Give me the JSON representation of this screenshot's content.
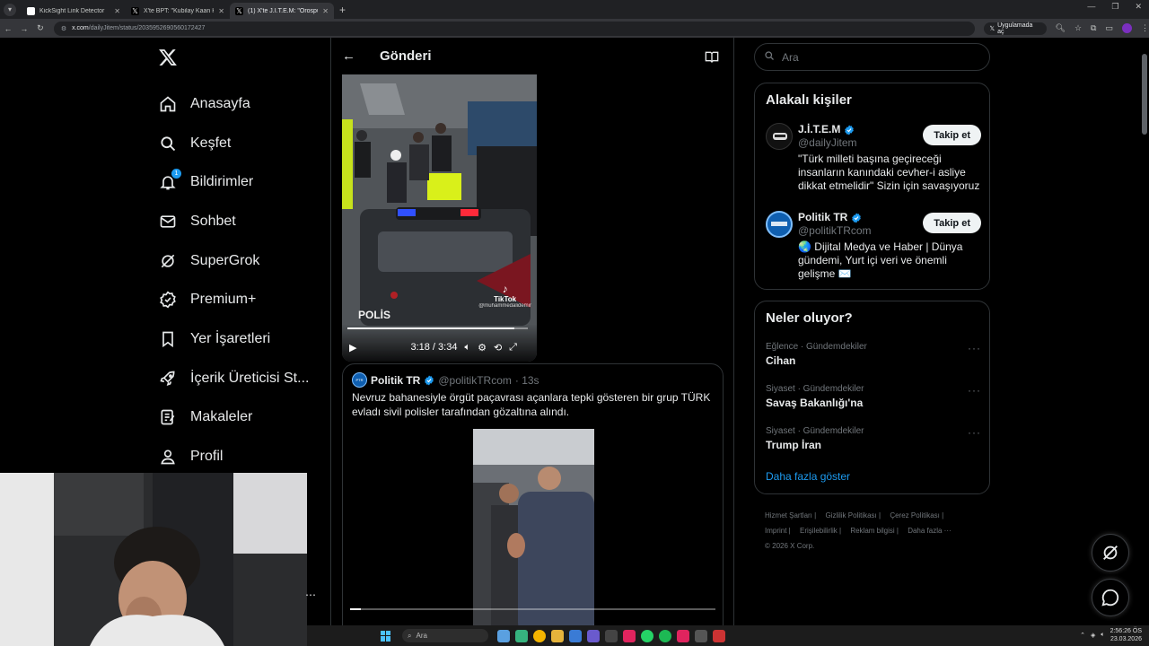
{
  "browser": {
    "tabs": [
      {
        "title": "KickSight Link Detector",
        "active": false
      },
      {
        "title": "X'te BPT: \"Kubilay Kaan Kundak...",
        "active": false
      },
      {
        "title": "(1) X'te J.İ.T.E.M: \"Orospu evladı...",
        "active": true
      }
    ],
    "new_tab": "+",
    "url_domain": "x.com",
    "url_path": "/dailyJitem/status/2035952690560172427",
    "open_in_app": "Uygulamada aç"
  },
  "sidebar": {
    "logo": "X",
    "items": [
      {
        "label": "Anasayfa",
        "icon": "home-icon"
      },
      {
        "label": "Keşfet",
        "icon": "search-icon"
      },
      {
        "label": "Bildirimler",
        "icon": "bell-icon",
        "badge": "1"
      },
      {
        "label": "Sohbet",
        "icon": "mail-icon"
      },
      {
        "label": "SuperGrok",
        "icon": "grok-icon"
      },
      {
        "label": "Premium+",
        "icon": "verified-icon"
      },
      {
        "label": "Yer İşaretleri",
        "icon": "bookmark-icon"
      },
      {
        "label": "İçerik Üreticisi St...",
        "icon": "rocket-icon"
      },
      {
        "label": "Makaleler",
        "icon": "article-icon"
      },
      {
        "label": "Profil",
        "icon": "user-icon"
      }
    ]
  },
  "main": {
    "header_title": "Gönderi",
    "video": {
      "time": "3:18 / 3:34",
      "progress": 0.925,
      "watermark": "TikTok",
      "watermark_user": "@muhammedalidemir",
      "car_text": "POLİS"
    },
    "quote": {
      "name": "Politik TR",
      "handle": "@politikTRcom",
      "time": "· 13s",
      "text": "Nevruz bahanesiyle örgüt paçavrası açanlara tepki gösteren bir grup TÜRK evladı sivil polisler tarafından gözaltına alındı.",
      "progress": 0.03
    }
  },
  "right": {
    "search_placeholder": "Ara",
    "related": {
      "title": "Alakalı kişiler",
      "people": [
        {
          "name": "J.İ.T.E.M",
          "handle": "@dailyJitem",
          "bio": "\"Türk milleti başına geçireceği insanların kanındaki cevher-i asliye dikkat etmelidir\" Sizin için savaşıyoruz",
          "follow": "Takip et"
        },
        {
          "name": "Politik TR",
          "handle": "@politikTRcom",
          "bio": "🌏 Dijital Medya ve Haber | Dünya gündemi, Yurt içi veri ve önemli gelişme ✉️",
          "follow": "Takip et"
        }
      ]
    },
    "trends": {
      "title": "Neler oluyor?",
      "items": [
        {
          "category": "Eğlence · Gündemdekiler",
          "name": "Cihan"
        },
        {
          "category": "Siyaset · Gündemdekiler",
          "name": "Savaş Bakanlığı'na"
        },
        {
          "category": "Siyaset · Gündemdekiler",
          "name": "Trump İran"
        }
      ],
      "show_more": "Daha fazla göster",
      "more": "···"
    },
    "footer": {
      "links": [
        "Hizmet Şartları |",
        "Gizlilik Politikası |",
        "Çerez Politikası |",
        "Imprint |",
        "Erişilebilirlik |",
        "Reklam bilgisi |",
        "Daha fazla ···"
      ],
      "copyright": "© 2026 X Corp."
    }
  },
  "taskbar": {
    "search_label": "Ara",
    "time": "2:56:26 ÖS",
    "date": "23.03.2026"
  },
  "colors": {
    "accent": "#1d9bf0",
    "background": "#000000",
    "border": "#2f3336",
    "muted": "#71767b"
  }
}
